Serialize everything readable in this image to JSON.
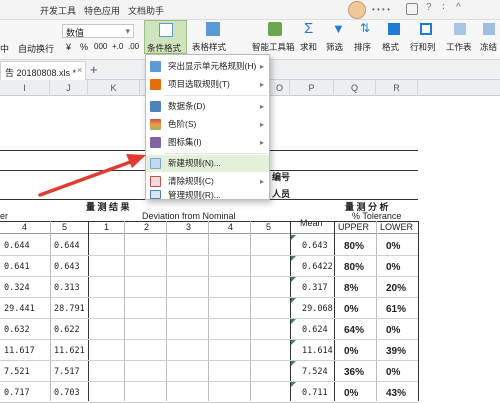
{
  "menubar": {
    "items": [
      "开发工具",
      "特色应用",
      "文档助手"
    ]
  },
  "user": {
    "name_icon": "avatar"
  },
  "ribbon": {
    "left_labels": [
      "中",
      "自动换行"
    ],
    "number_format": "数值",
    "symbols": [
      "¥",
      "%",
      "000",
      "+.0",
      ".00"
    ],
    "cond_format": "条件格式",
    "table_style": "表格样式",
    "smart_toolbox": "智能工具箱",
    "sum": "求和",
    "filter": "筛选",
    "sort": "排序",
    "format": "格式",
    "row_col": "行和列",
    "worksheet": "工作表",
    "add": "冻结"
  },
  "tabs": {
    "doc_name": "告 20180808.xls *",
    "close": "×",
    "new": "+"
  },
  "columns": [
    "I",
    "J",
    "K",
    "L",
    "M",
    "N",
    "O",
    "P",
    "Q",
    "R"
  ],
  "dropdown": {
    "items": [
      {
        "label": "突出显示单元格规则(H)",
        "arrow": "▸"
      },
      {
        "label": "项目选取规则(T)",
        "arrow": "▸"
      },
      {
        "label": "数据条(D)",
        "arrow": "▸"
      },
      {
        "label": "色阶(S)",
        "arrow": "▸"
      },
      {
        "label": "图标集(I)",
        "arrow": "▸"
      },
      {
        "label": "新建规则(N)...",
        "arrow": ""
      },
      {
        "label": "清除规则(C)",
        "arrow": "▸"
      },
      {
        "label": "管理规则(R)...",
        "arrow": ""
      }
    ]
  },
  "sheet": {
    "label_bianhao": "编号",
    "label_renyuan": "人员",
    "measure_result": "量 测 结 果",
    "measure_analysis": "量 测 分 析",
    "er": "er",
    "deviation": "Deviation from Nominal",
    "mean": "Mean",
    "tolerance": "% Tolerance",
    "upper": "UPPER",
    "lower": "LOWER",
    "col_nums": [
      "4",
      "5",
      "1",
      "2",
      "3",
      "4",
      "5"
    ],
    "rows": [
      {
        "a": "0.644",
        "b": "0.644",
        "mean": "0.643",
        "up": "80%",
        "low": "0%"
      },
      {
        "a": "0.641",
        "b": "0.643",
        "mean": "0.6422",
        "up": "80%",
        "low": "0%"
      },
      {
        "a": "0.324",
        "b": "0.313",
        "mean": "0.317",
        "up": "8%",
        "low": "20%"
      },
      {
        "a": "29.441",
        "b": "28.791",
        "mean": "29.068",
        "up": "0%",
        "low": "61%"
      },
      {
        "a": "0.632",
        "b": "0.622",
        "mean": "0.624",
        "up": "64%",
        "low": "0%"
      },
      {
        "a": "11.617",
        "b": "11.621",
        "mean": "11.614",
        "up": "0%",
        "low": "39%"
      },
      {
        "a": "7.521",
        "b": "7.517",
        "mean": "7.524",
        "up": "36%",
        "low": "0%"
      },
      {
        "a": "0.717",
        "b": "0.703",
        "mean": "0.711",
        "up": "0%",
        "low": "43%"
      }
    ]
  },
  "colors": {
    "accent": "#1e7bd6",
    "highlight": "#e4f0da",
    "arrow": "#e03c31"
  }
}
